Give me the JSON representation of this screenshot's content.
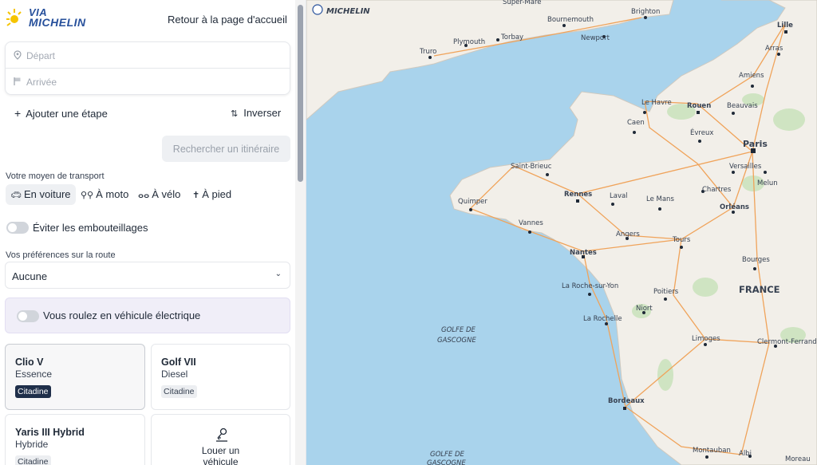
{
  "header": {
    "logo_line1": "VIA",
    "logo_line2": "MICHELIN",
    "home_link": "Retour à la page d'accueil"
  },
  "route": {
    "start_placeholder": "Départ",
    "end_placeholder": "Arrivée",
    "add_step": "Ajouter une étape",
    "invert": "Inverser",
    "search_button": "Rechercher un itinéraire"
  },
  "transport": {
    "label": "Votre moyen de transport",
    "options": [
      {
        "label": "En voiture",
        "icon": "car-icon",
        "active": true
      },
      {
        "label": "À moto",
        "icon": "motorbike-icon",
        "active": false
      },
      {
        "label": "À vélo",
        "icon": "bicycle-icon",
        "active": false
      },
      {
        "label": "À pied",
        "icon": "walker-icon",
        "active": false
      }
    ]
  },
  "traffic": {
    "label": "Éviter les embouteillages",
    "enabled": false
  },
  "preferences": {
    "label": "Vos préférences sur la route",
    "value": "Aucune"
  },
  "electric": {
    "label": "Vous roulez en véhicule électrique",
    "enabled": false
  },
  "vehicles": [
    {
      "name": "Clio V",
      "fuel": "Essence",
      "tag": "Citadine",
      "selected": true
    },
    {
      "name": "Golf VII",
      "fuel": "Diesel",
      "tag": "Citadine",
      "selected": false
    },
    {
      "name": "Yaris III Hybrid",
      "fuel": "Hybride",
      "tag": "Citadine",
      "selected": false
    }
  ],
  "rent": {
    "line1": "Louer un",
    "line2": "véhicule"
  },
  "map": {
    "brand": "MICHELIN",
    "country": "FRANCE",
    "sea_line1": "GOLFE DE",
    "sea_line2": "GASCOGNE",
    "cities": {
      "lille": "Lille",
      "arras": "Arras",
      "amiens": "Amiens",
      "rouen": "Rouen",
      "beauvais": "Beauvais",
      "lehavre": "Le Havre",
      "caen": "Caen",
      "evreux": "Évreux",
      "paris": "Paris",
      "versailles": "Versailles",
      "melun": "Melun",
      "chartres": "Chartres",
      "orleans": "Orléans",
      "rennes": "Rennes",
      "laval": "Laval",
      "lemans": "Le Mans",
      "saintbrieuc": "Saint-Brieuc",
      "quimper": "Quimper",
      "vannes": "Vannes",
      "angers": "Angers",
      "tours": "Tours",
      "nantes": "Nantes",
      "bourges": "Bourges",
      "larochesuryon": "La Roche-sur-Yon",
      "poitiers": "Poitiers",
      "niort": "Niort",
      "larochelle": "La Rochelle",
      "limoges": "Limoges",
      "clermont": "Clermont-Ferrand",
      "bordeaux": "Bordeaux",
      "montauban": "Montauban",
      "albi": "Albi",
      "plymouth": "Plymouth",
      "torbay": "Torbay",
      "truro": "Truro",
      "bournemouth": "Bournemouth",
      "brighton": "Brighton",
      "newport": "Newport",
      "supermare": "Super-Mare",
      "moreau": "Moreau"
    }
  }
}
